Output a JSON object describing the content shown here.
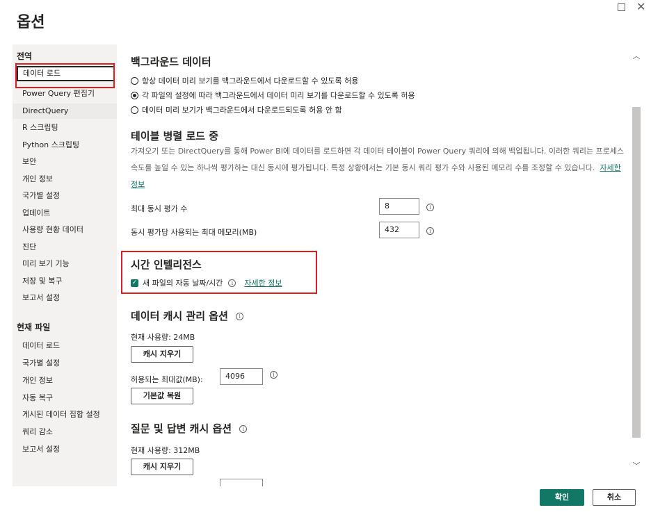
{
  "window": {
    "title": "옵션"
  },
  "sidebar": {
    "global_header": "전역",
    "global_items": [
      {
        "label": "데이터 로드"
      },
      {
        "label": "Power Query 편집기"
      },
      {
        "label": "DirectQuery"
      },
      {
        "label": "R 스크립팅"
      },
      {
        "label": "Python 스크립팅"
      },
      {
        "label": "보안"
      },
      {
        "label": "개인 정보"
      },
      {
        "label": "국가별 설정"
      },
      {
        "label": "업데이트"
      },
      {
        "label": "사용량 현황 데이터"
      },
      {
        "label": "진단"
      },
      {
        "label": "미리 보기 기능"
      },
      {
        "label": "저장 및 복구"
      },
      {
        "label": "보고서 설정"
      }
    ],
    "file_header": "현재 파일",
    "file_items": [
      {
        "label": "데이터 로드"
      },
      {
        "label": "국가별 설정"
      },
      {
        "label": "개인 정보"
      },
      {
        "label": "자동 복구"
      },
      {
        "label": "게시된 데이터 집합 설정"
      },
      {
        "label": "쿼리 감소"
      },
      {
        "label": "보고서 설정"
      }
    ]
  },
  "background_data": {
    "title": "백그라운드 데이터",
    "options": [
      "항상 데이터 미리 보기를 백그라운드에서 다운로드할 수 있도록 허용",
      "각 파일의 설정에 따라 백그라운드에서 데이터 미리 보기를 다운로드할 수 있도록 허용",
      "데이터 미리 보기가 백그라운드에서 다운로드되도록 허용 안 함"
    ],
    "selected_index": 1
  },
  "parallel_load": {
    "title": "테이블 병렬 로드 중",
    "description": "가져오기 또는 DirectQuery를 통해 Power BI에 데이터를 로드하면 각 데이터 테이블이 Power Query 쿼리에 의해 백업됩니다. 이러한 쿼리는 프로세스 속도를 높일 수 있는 하나씩 평가하는 대신 동시에 평가됩니다. 특정 상황에서는 기본 동시 쿼리 평가 수와 사용된 메모리 수를 조정할 수 있습니다.",
    "learn_more": "자세한 정보",
    "max_eval_label": "최대 동시 평가 수",
    "max_eval_value": "8",
    "max_memory_label": "동시 평가당 사용되는 최대 메모리(MB)",
    "max_memory_value": "432"
  },
  "time_intelligence": {
    "title": "시간 인텔리전스",
    "checkbox_label": "새 파일의 자동 날짜/시간",
    "checked": true,
    "learn_more": "자세한 정보"
  },
  "data_cache": {
    "title": "데이터 캐시 관리 옵션",
    "usage": "현재 사용량: 24MB",
    "clear_button": "캐시 지우기",
    "max_label": "허용되는 최대값(MB):",
    "max_value": "4096",
    "restore_button": "기본값 복원"
  },
  "qa_cache": {
    "title": "질문 및 답변 캐시 옵션",
    "usage": "현재 사용량: 312MB",
    "clear_button": "캐시 지우기"
  },
  "footer": {
    "ok_label": "확인",
    "cancel_label": "취소"
  },
  "colors": {
    "accent": "#117865",
    "highlight": "#e01e1e",
    "sidebar_bg": "#f3f2f1"
  }
}
